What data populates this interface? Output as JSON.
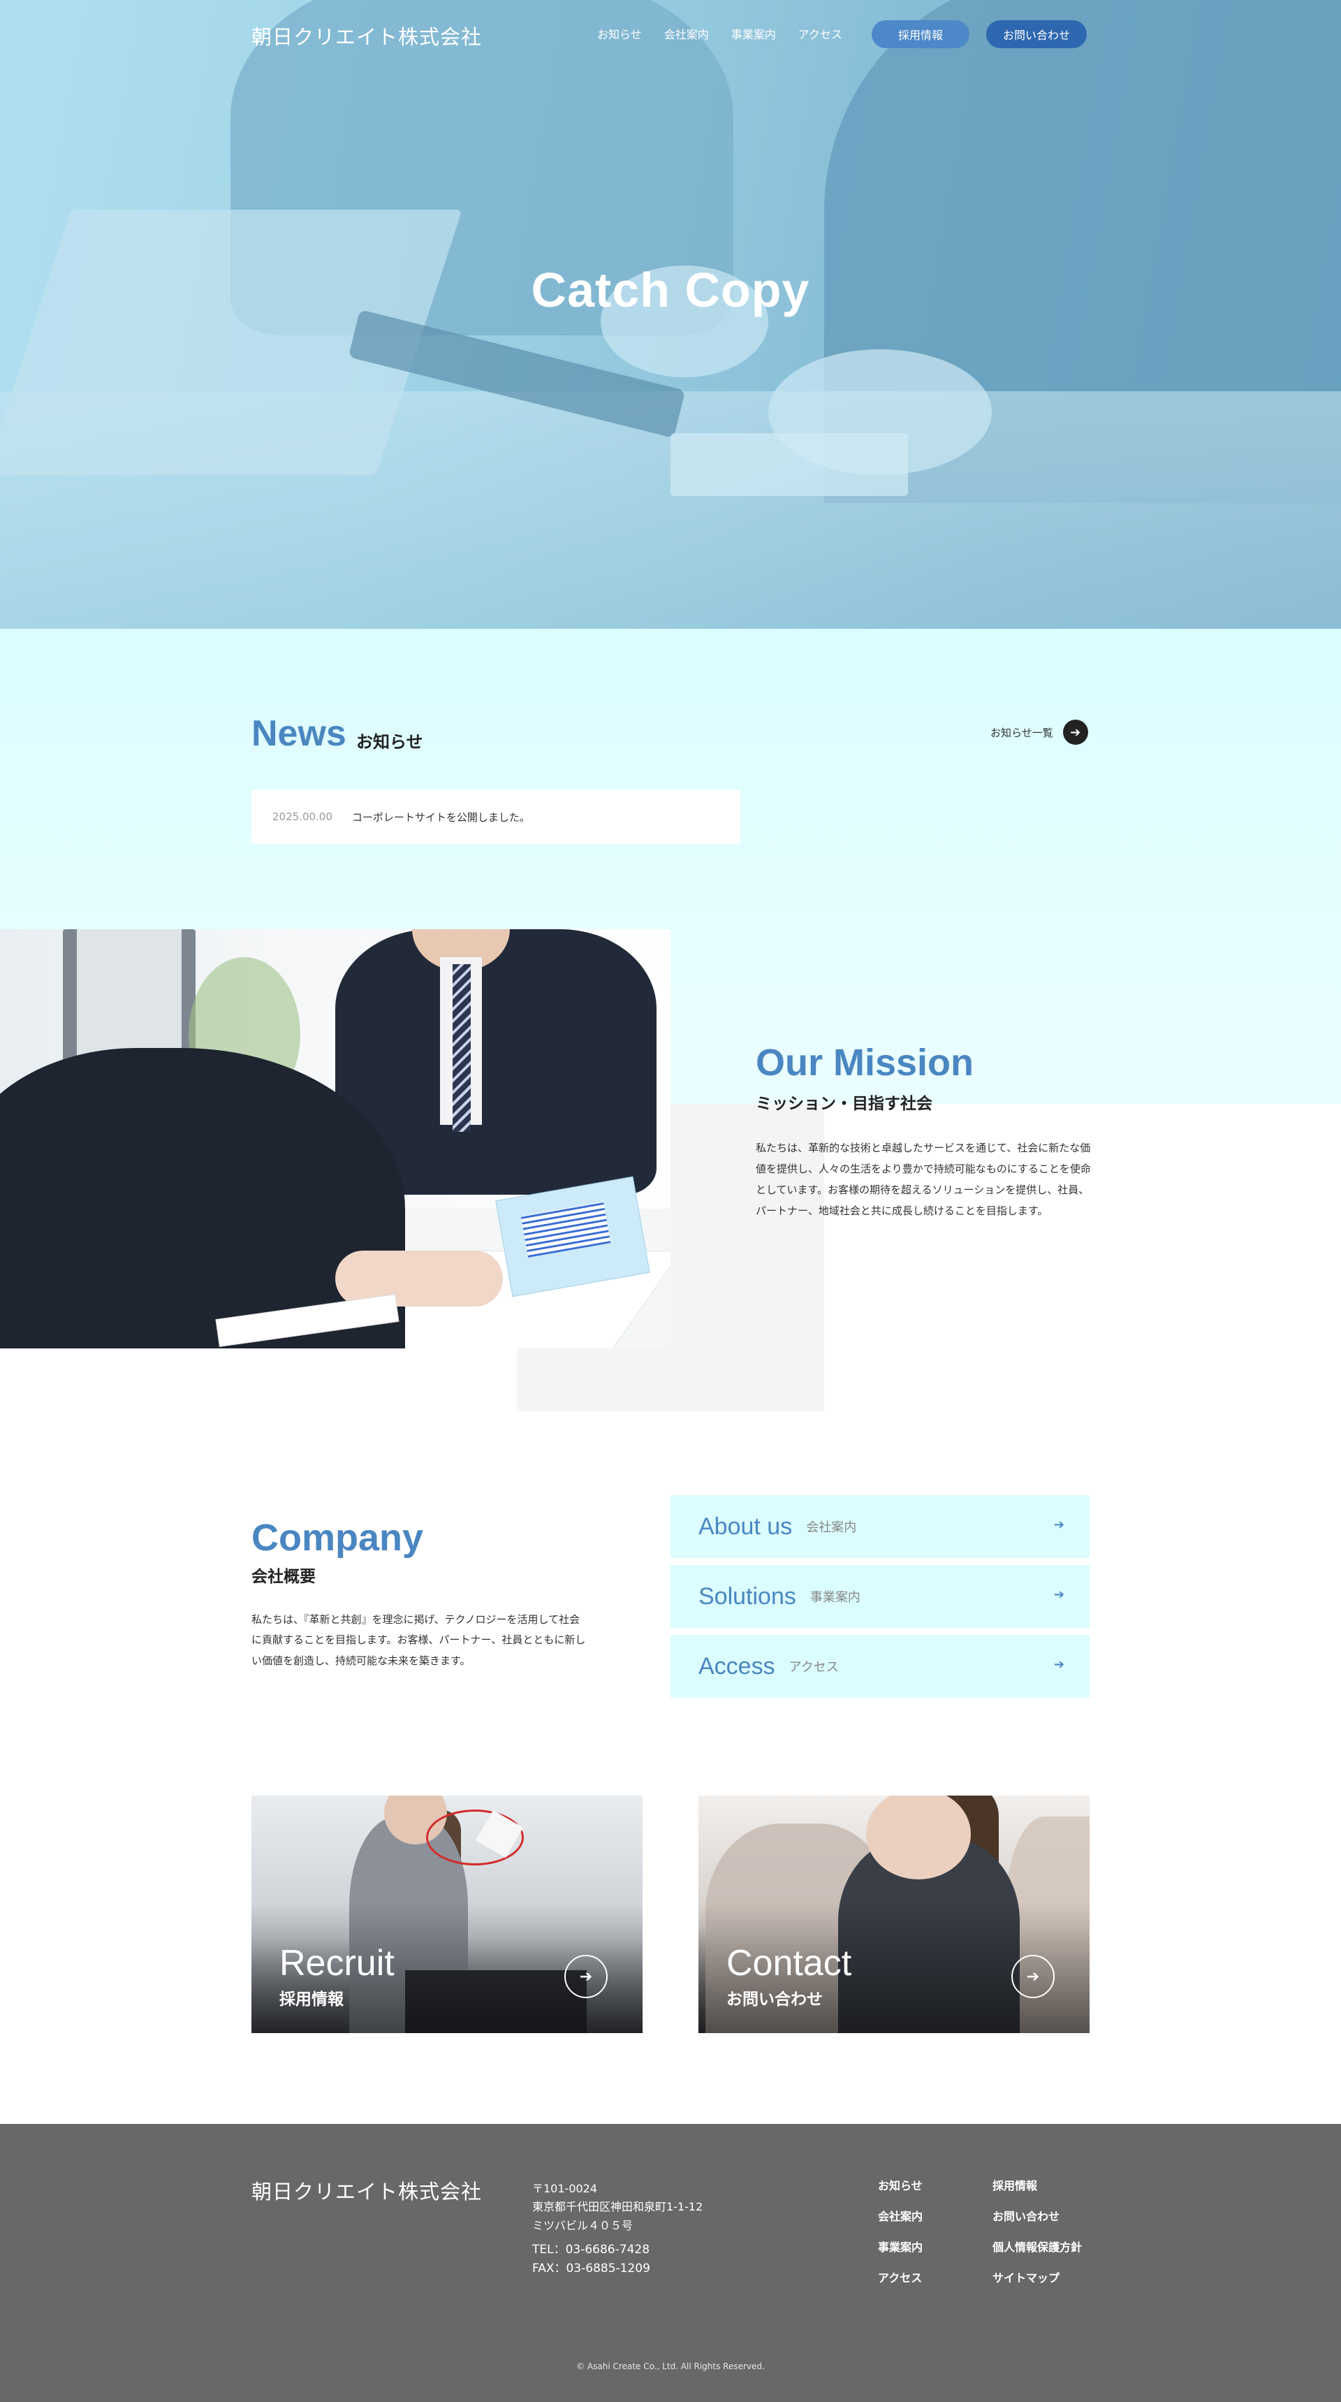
{
  "header": {
    "logo": "朝日クリエイト株式会社",
    "nav": [
      "お知らせ",
      "会社案内",
      "事業案内",
      "アクセス"
    ],
    "recruit_button": "採用情報",
    "contact_button": "お問い合わせ"
  },
  "hero": {
    "catch_copy": "Catch Copy"
  },
  "news": {
    "title": "News",
    "subtitle": "お知らせ",
    "more_label": "お知らせ一覧",
    "items": [
      {
        "date": "2025.00.00",
        "text": "コーポレートサイトを公開しました。"
      }
    ]
  },
  "mission": {
    "title": "Our Mission",
    "subtitle": "ミッション・目指す社会",
    "body": "私たちは、革新的な技術と卓越したサービスを通じて、社会に新たな価値を提供し、人々の生活をより豊かで持続可能なものにすることを使命としています。お客様の期待を超えるソリューションを提供し、社員、パートナー、地域社会と共に成長し続けることを目指します。"
  },
  "company": {
    "title": "Company",
    "subtitle": "会社概要",
    "body": "私たちは、『革新と共創』を理念に掲げ、テクノロジーを活用して社会に貢献することを目指します。お客様、パートナー、社員とともに新しい価値を創造し、持続可能な未来を築きます。",
    "links": [
      {
        "en": "About us",
        "ja": "会社案内"
      },
      {
        "en": "Solutions",
        "ja": "事業案内"
      },
      {
        "en": "Access",
        "ja": "アクセス"
      }
    ]
  },
  "cards": {
    "recruit": {
      "en": "Recruit",
      "ja": "採用情報"
    },
    "contact": {
      "en": "Contact",
      "ja": "お問い合わせ"
    }
  },
  "footer": {
    "logo": "朝日クリエイト株式会社",
    "postal": "〒101-0024",
    "address1": "東京都千代田区神田和泉町1-1-12",
    "address2": "ミツバビル４０５号",
    "tel": "TEL：03-6686-7428",
    "fax": "FAX：03-6885-1209",
    "nav": [
      "お知らせ",
      "採用情報",
      "会社案内",
      "お問い合わせ",
      "事業案内",
      "個人情報保護方針",
      "アクセス",
      "サイトマップ"
    ],
    "copyright": "© Asahi Create Co., Ltd. All Rights Reserved."
  },
  "icons": {
    "arrow": "arrow-right-icon"
  },
  "colors": {
    "accent": "#4a86c1",
    "light_cyan": "#dbfdff",
    "footer_bg": "#686868",
    "recruit_button": "#4d88c9",
    "contact_button": "#2d67b0"
  }
}
